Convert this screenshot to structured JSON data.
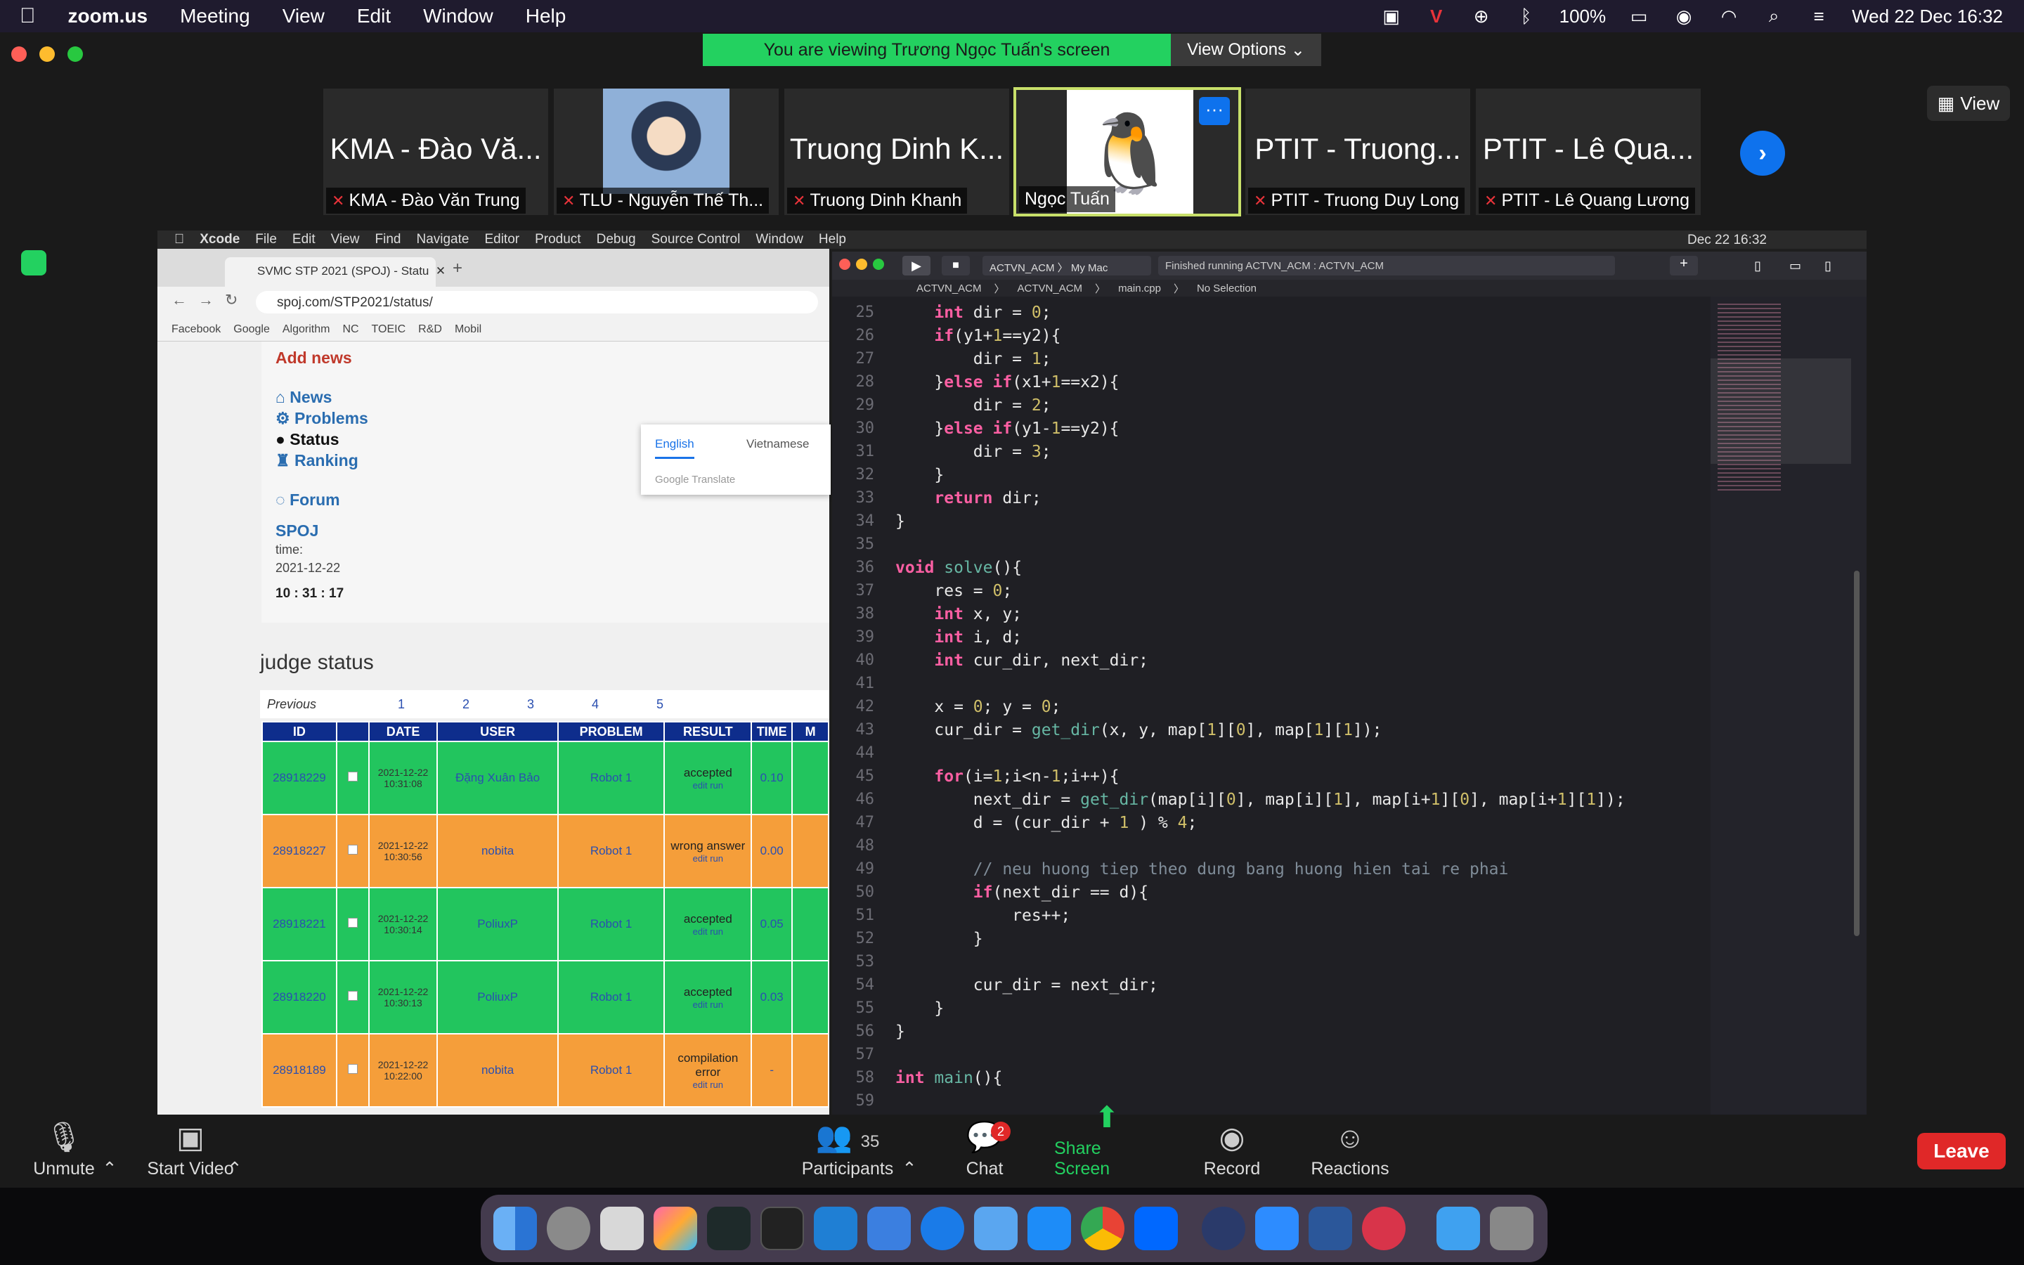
{
  "menubar": {
    "app": "zoom.us",
    "items": [
      "Meeting",
      "View",
      "Edit",
      "Window",
      "Help"
    ],
    "battery": "100%",
    "datetime": "Wed 22 Dec  16:32"
  },
  "zoom": {
    "viewing_banner": "You are viewing Trương Ngọc Tuấn's screen",
    "view_options": "View Options",
    "view_button": "View",
    "participants": [
      {
        "big": "KMA - Đào Vă...",
        "label": "KMA - Đào Văn Trung"
      },
      {
        "big": "",
        "label": "TLU - Nguyễn Thế Th..."
      },
      {
        "big": "Truong Dinh K...",
        "label": "Truong Dinh Khanh"
      },
      {
        "big": "",
        "label": "Ngọc Tuấn"
      },
      {
        "big": "PTIT - Truong...",
        "label": "PTIT - Truong Duy Long"
      },
      {
        "big": "PTIT - Lê Qua...",
        "label": "PTIT - Lê Quang Lương"
      }
    ],
    "controls": {
      "unmute": "Unmute",
      "start_video": "Start Video",
      "participants": "Participants",
      "participants_count": "35",
      "chat": "Chat",
      "chat_badge": "2",
      "share": "Share Screen",
      "record": "Record",
      "reactions": "Reactions",
      "leave": "Leave"
    }
  },
  "shared": {
    "xcode_menu": [
      "Xcode",
      "File",
      "Edit",
      "View",
      "Find",
      "Navigate",
      "Editor",
      "Product",
      "Debug",
      "Source Control",
      "Window",
      "Help"
    ],
    "xcode_clock": "Dec 22  16:32",
    "browser": {
      "tab_title": "SVMC STP 2021 (SPOJ) - Statu",
      "url": "spoj.com/STP2021/status/",
      "bookmarks": [
        "Facebook",
        "Google",
        "Algorithm",
        "NC",
        "TOEIC",
        "R&D",
        "Mobil"
      ],
      "translate_tabs": [
        "English",
        "Vietnamese"
      ],
      "translate_label": "Google Translate",
      "add_news": "Add news",
      "nav": [
        "News",
        "Problems",
        "Status",
        "Ranking",
        "Forum"
      ],
      "spoj": "SPOJ",
      "time_label": "time:",
      "date": "2021-12-22",
      "clock": "10 : 31 : 17",
      "judge_title": "judge status",
      "previous": "Previous",
      "pages": [
        "1",
        "2",
        "3",
        "4",
        "5"
      ],
      "columns": [
        "ID",
        "",
        "DATE",
        "USER",
        "PROBLEM",
        "RESULT",
        "TIME",
        "M"
      ],
      "rows": [
        {
          "id": "28918229",
          "date": "2021-12-22 10:31:08",
          "user": "Đặng Xuân Bảo",
          "problem": "Robot 1",
          "result": "accepted",
          "time": "0.10",
          "color": "#22c55e"
        },
        {
          "id": "28918227",
          "date": "2021-12-22 10:30:56",
          "user": "nobita",
          "problem": "Robot 1",
          "result": "wrong answer",
          "time": "0.00",
          "color": "#f59e3a"
        },
        {
          "id": "28918221",
          "date": "2021-12-22 10:30:14",
          "user": "PoliuxP",
          "problem": "Robot 1",
          "result": "accepted",
          "time": "0.05",
          "color": "#22c55e"
        },
        {
          "id": "28918220",
          "date": "2021-12-22 10:30:13",
          "user": "PoliuxP",
          "problem": "Robot 1",
          "result": "accepted",
          "time": "0.03",
          "color": "#22c55e"
        },
        {
          "id": "28918189",
          "date": "2021-12-22 10:22:00",
          "user": "nobita",
          "problem": "Robot 1",
          "result": "compilation error",
          "time": "-",
          "color": "#f59e3a"
        }
      ],
      "edit_run": "edit  run"
    },
    "xcode": {
      "scheme": "ACTVN_ACM",
      "destination": "My Mac",
      "status": "Finished running ACTVN_ACM : ACTVN_ACM",
      "path": [
        "ACTVN_ACM",
        "ACTVN_ACM",
        "main.cpp",
        "No Selection"
      ]
    }
  }
}
